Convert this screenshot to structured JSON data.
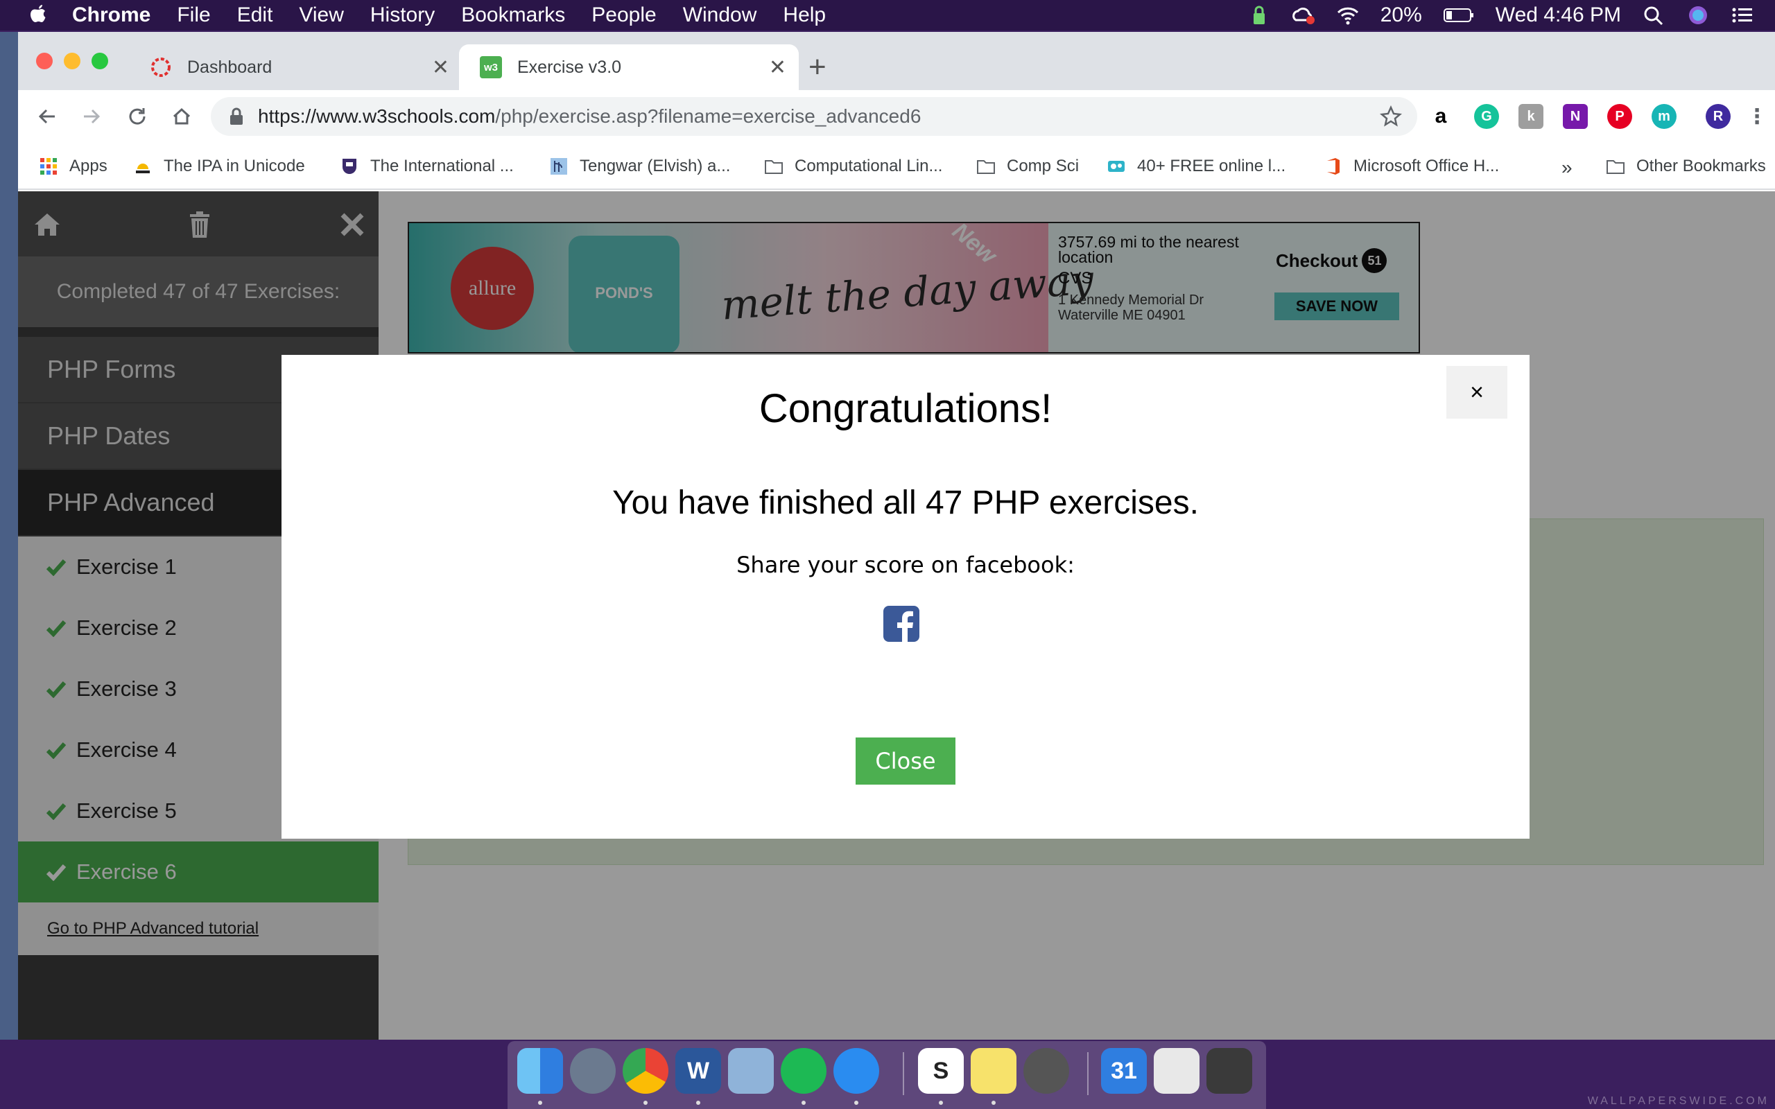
{
  "menubar": {
    "app_name": "Chrome",
    "items": [
      "File",
      "Edit",
      "View",
      "History",
      "Bookmarks",
      "People",
      "Window",
      "Help"
    ],
    "battery": "20%",
    "clock": "Wed 4:46 PM"
  },
  "tabs": [
    {
      "title": "Dashboard"
    },
    {
      "title": "Exercise v3.0",
      "active": true
    }
  ],
  "address_bar": {
    "host": "https://www.w3schools.com",
    "path": "/php/exercise.asp?filename=exercise_advanced6"
  },
  "profile_initial": "R",
  "bookmarks": {
    "items": [
      "Apps",
      "The IPA in Unicode",
      "The International ...",
      "Tengwar (Elvish) a...",
      "Computational Lin...",
      "Comp Sci",
      "40+ FREE online l...",
      "Microsoft Office H..."
    ],
    "overflow": "»",
    "other": "Other Bookmarks"
  },
  "sidebar": {
    "completed": "Completed 47 of 47 Exercises:",
    "sections": [
      "PHP Forms",
      "PHP Dates",
      "PHP Advanced"
    ],
    "exercises": [
      "Exercise 1",
      "Exercise 2",
      "Exercise 3",
      "Exercise 4",
      "Exercise 5",
      "Exercise 6"
    ],
    "tutorial_link": "Go to PHP Advanced tutorial"
  },
  "ad": {
    "badge": "allure",
    "product": "POND'S",
    "slogan": "melt the day away",
    "tag": "New",
    "distance": "3757.69 mi to the nearest location",
    "store": "CVS",
    "address_line1": "1 Kennedy Memorial Dr",
    "address_line2": "Waterville ME 04901",
    "brand": "Checkout",
    "brand_num": "51",
    "cta": "SAVE NOW"
  },
  "modal": {
    "close_symbol": "×",
    "title": "Congratulations!",
    "message": "You have finished all 47 PHP exercises.",
    "share": "Share your score on facebook:",
    "button": "Close"
  },
  "dock": {
    "calendar_day": "31"
  },
  "watermark": "WALLPAPERSWIDE.COM",
  "colors": {
    "accent_green": "#4caf50",
    "sidebar_dark": "#3d3d3d",
    "facebook_blue": "#3b5998",
    "desktop_purple": "#3b1f5e"
  }
}
